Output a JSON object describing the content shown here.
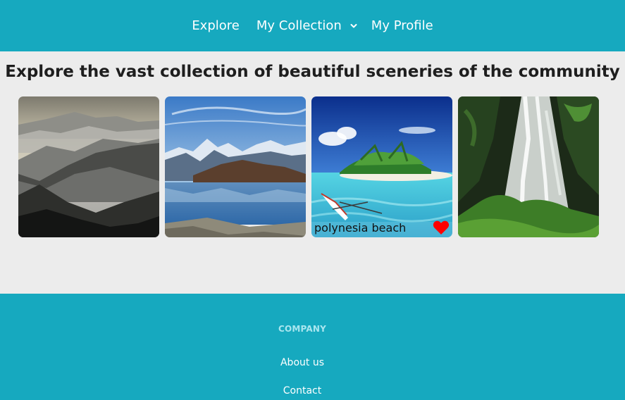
{
  "nav": {
    "explore": "Explore",
    "my_collection": "My Collection",
    "my_profile": "My Profile"
  },
  "page_title": "Explore the vast collection of beautiful sceneries of the community",
  "gallery": [
    {
      "scene": "misty-mountains"
    },
    {
      "scene": "alpine-lake"
    },
    {
      "scene": "tropical-beach",
      "caption": "polynesia beach",
      "liked": true
    },
    {
      "scene": "waterfall"
    }
  ],
  "footer": {
    "heading": "COMPANY",
    "links": [
      "About us",
      "Contact"
    ]
  },
  "colors": {
    "brand": "#16a9bf",
    "page_bg": "#ececec",
    "heart": "#ff0000",
    "footer_heading": "#a9e6ef"
  }
}
